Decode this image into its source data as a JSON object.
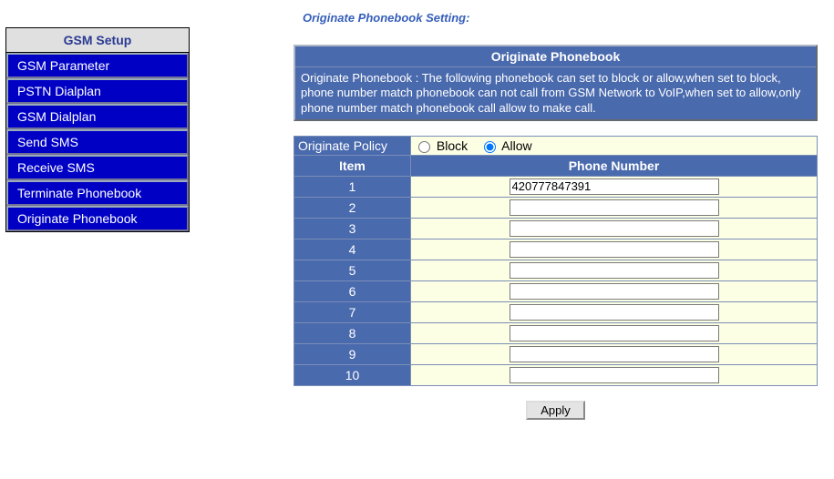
{
  "sidebar": {
    "header": "GSM Setup",
    "items": [
      "GSM Parameter",
      "PSTN Dialplan",
      "GSM Dialplan",
      "Send SMS",
      "Receive SMS",
      "Terminate Phonebook",
      "Originate Phonebook"
    ]
  },
  "page": {
    "title": "Originate Phonebook Setting:"
  },
  "panel": {
    "header": "Originate Phonebook",
    "body": "Originate Phonebook : The following phonebook can set to block or allow,when set to block, phone number match phonebook can not call from GSM Network to VoIP,when set to allow,only phone number match phonebook call allow to make call."
  },
  "policy": {
    "label": "Originate Policy",
    "block_label": "Block",
    "allow_label": "Allow",
    "selected": "allow"
  },
  "table": {
    "col_item": "Item",
    "col_phone": "Phone Number",
    "rows": [
      {
        "item": "1",
        "value": "420777847391"
      },
      {
        "item": "2",
        "value": ""
      },
      {
        "item": "3",
        "value": ""
      },
      {
        "item": "4",
        "value": ""
      },
      {
        "item": "5",
        "value": ""
      },
      {
        "item": "6",
        "value": ""
      },
      {
        "item": "7",
        "value": ""
      },
      {
        "item": "8",
        "value": ""
      },
      {
        "item": "9",
        "value": ""
      },
      {
        "item": "10",
        "value": ""
      }
    ]
  },
  "buttons": {
    "apply": "Apply"
  }
}
